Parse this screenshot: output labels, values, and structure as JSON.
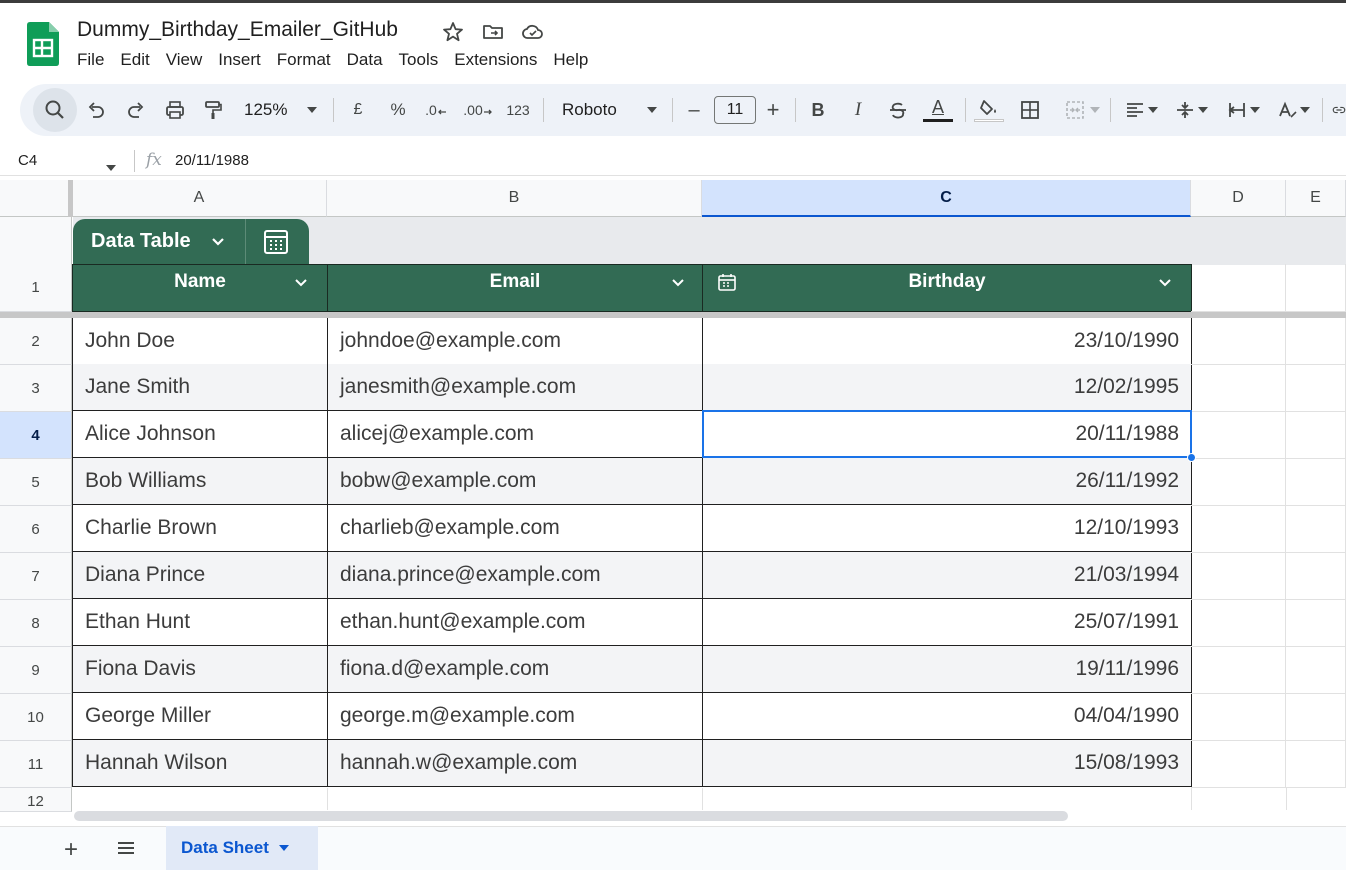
{
  "app": {
    "title": "Dummy_Birthday_Emailer_GitHub"
  },
  "menu": [
    "File",
    "Edit",
    "View",
    "Insert",
    "Format",
    "Data",
    "Tools",
    "Extensions",
    "Help"
  ],
  "toolbar": {
    "zoom": "125%",
    "currency": "£",
    "percent": "%",
    "dec_decrease": ".0",
    "dec_increase": ".00",
    "number_format": "123",
    "font": "Roboto",
    "font_size": "11",
    "minus": "–",
    "plus": "+",
    "bold": "B",
    "italic": "I",
    "text_color": "A"
  },
  "formula_bar": {
    "cell_ref": "C4",
    "fx": "fx",
    "value": "20/11/1988"
  },
  "columns": [
    "A",
    "B",
    "C",
    "D",
    "E"
  ],
  "table": {
    "name": "Data Table",
    "headers": [
      "Name",
      "Email",
      "Birthday"
    ],
    "rows": [
      [
        "John Doe",
        "johndoe@example.com",
        "23/10/1990"
      ],
      [
        "Jane Smith",
        "janesmith@example.com",
        "12/02/1995"
      ],
      [
        "Alice Johnson",
        "alicej@example.com",
        "20/11/1988"
      ],
      [
        "Bob Williams",
        "bobw@example.com",
        "26/11/1992"
      ],
      [
        "Charlie Brown",
        "charlieb@example.com",
        "12/10/1993"
      ],
      [
        "Diana Prince",
        "diana.prince@example.com",
        "21/03/1994"
      ],
      [
        "Ethan Hunt",
        "ethan.hunt@example.com",
        "25/07/1991"
      ],
      [
        "Fiona Davis",
        "fiona.d@example.com",
        "19/11/1996"
      ],
      [
        "George Miller",
        "george.m@example.com",
        "04/04/1990"
      ],
      [
        "Hannah Wilson",
        "hannah.w@example.com",
        "15/08/1993"
      ]
    ]
  },
  "row_numbers": [
    "1",
    "2",
    "3",
    "4",
    "5",
    "6",
    "7",
    "8",
    "9",
    "10",
    "11",
    "12"
  ],
  "selected": {
    "column": "C",
    "row": "4"
  },
  "sheet_tab": {
    "label": "Data Sheet",
    "add": "+"
  },
  "colors": {
    "table_header": "#326b54",
    "selection": "#1a73e8",
    "sheet_tab_text": "#0b57d0"
  }
}
